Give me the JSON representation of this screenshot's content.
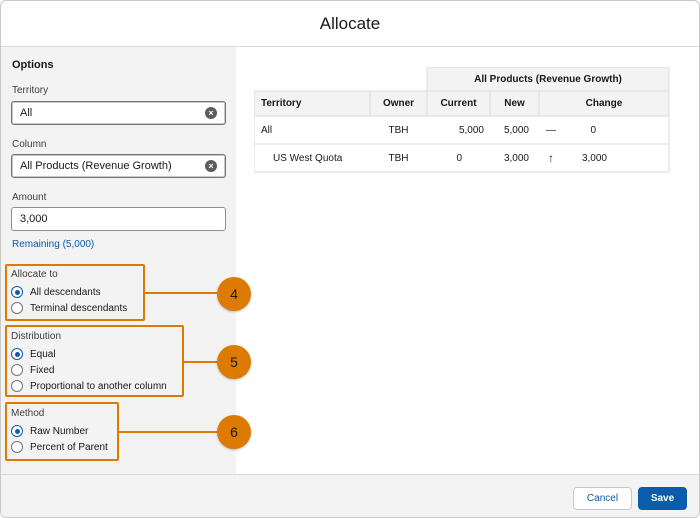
{
  "modal": {
    "title": "Allocate"
  },
  "options": {
    "title": "Options",
    "territory": {
      "label": "Territory",
      "value": "All"
    },
    "column": {
      "label": "Column",
      "value": "All Products (Revenue Growth)"
    },
    "amount": {
      "label": "Amount",
      "value": "3,000"
    },
    "remaining": "Remaining (5,000)",
    "allocate_to": {
      "label": "Allocate to",
      "options": [
        {
          "label": "All descendants",
          "checked": true
        },
        {
          "label": "Terminal descendants",
          "checked": false
        }
      ]
    },
    "distribution": {
      "label": "Distribution",
      "options": [
        {
          "label": "Equal",
          "checked": true
        },
        {
          "label": "Fixed",
          "checked": false
        },
        {
          "label": "Proportional to another column",
          "checked": false
        }
      ]
    },
    "method": {
      "label": "Method",
      "options": [
        {
          "label": "Raw Number",
          "checked": true
        },
        {
          "label": "Percent of Parent",
          "checked": false
        }
      ]
    }
  },
  "callouts": [
    "4",
    "5",
    "6"
  ],
  "grid": {
    "group_header": "All Products (Revenue Growth)",
    "columns": [
      "Territory",
      "Owner",
      "Current",
      "New",
      "Change"
    ],
    "rows": [
      {
        "territory": "All",
        "owner": "TBH",
        "current": "5,000",
        "new": "5,000",
        "change_icon": "—",
        "change": "0"
      },
      {
        "territory": "US West Quota",
        "owner": "TBH",
        "current": "0",
        "new": "3,000",
        "change_icon": "↑",
        "change": "3,000"
      }
    ]
  },
  "footer": {
    "cancel_label": "Cancel",
    "save_label": "Save"
  },
  "colors": {
    "accent": "#0b5cab",
    "callout": "#dd7a01"
  }
}
